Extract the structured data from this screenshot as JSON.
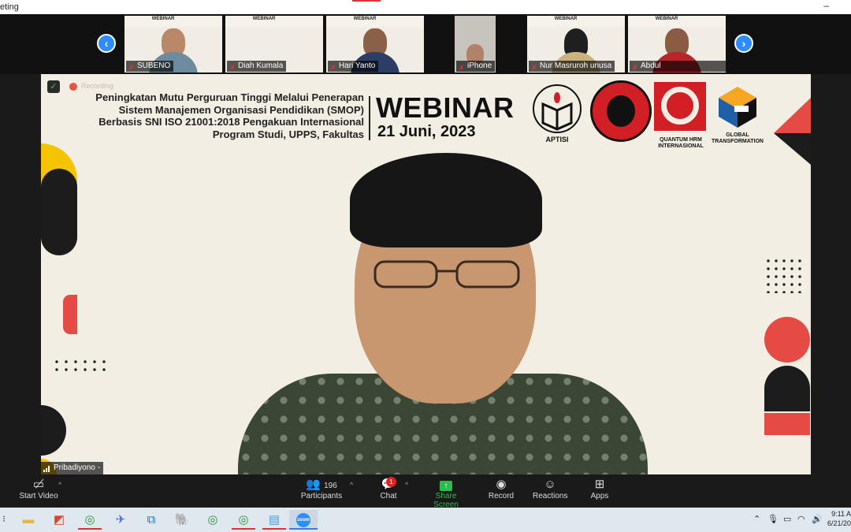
{
  "window": {
    "title": "eting",
    "minimize": "–"
  },
  "gallery": {
    "prev_icon": "chevron-left-icon",
    "next_icon": "chevron-right-icon",
    "participants": [
      {
        "name": "SUBENO",
        "muted": true,
        "shirt": "#6e8a9e"
      },
      {
        "name": "Diah Kumala",
        "muted": true,
        "shirt": ""
      },
      {
        "name": "Hari Yanto",
        "muted": true,
        "shirt": "#2c3e66"
      },
      {
        "name": "iPhone",
        "muted": true,
        "shirt": "#5a5a5a"
      },
      {
        "name": "Nur Masruroh unusa",
        "muted": true,
        "shirt": "#c9b27e"
      },
      {
        "name": "Abdul Wahid_Kemena...",
        "muted": true,
        "shirt": "#b8262c"
      }
    ],
    "thumb_banner": "WEBINAR"
  },
  "main_video": {
    "recording_label": "Recording",
    "banner_lines": [
      "Peningkatan Mutu Perguruan Tinggi Melalui Penerapan",
      "Sistem Manajemen Organisasi Pendidikan (SMOP)",
      "Berbasis SNI ISO 21001:2018 Pengakuan Internasional",
      "Program Studi, UPPS, Fakultas"
    ],
    "webinar": "WEBINAR",
    "date": "21 Juni, 2023",
    "logos": {
      "aptisi": "APTISI",
      "quantum": "QUANTUM HRM INTERNASIONAL",
      "global": "GLOBAL TRANSFORMATION"
    },
    "speaker_name": "Pribadiyono -"
  },
  "toolbar": {
    "start_video": "Start Video",
    "participants": "Participants",
    "participants_count": "196",
    "chat": "Chat",
    "chat_badge": "1",
    "share_screen": "Share Screen",
    "record": "Record",
    "reactions": "Reactions",
    "apps": "Apps"
  },
  "taskbar": {
    "time": "9:11 A",
    "date": "6/21/20",
    "zoom_label": "zoom"
  },
  "colors": {
    "accent": "#2d8cff",
    "share": "#2bbd4c",
    "red": "#d11f25",
    "badge": "#e02424"
  }
}
